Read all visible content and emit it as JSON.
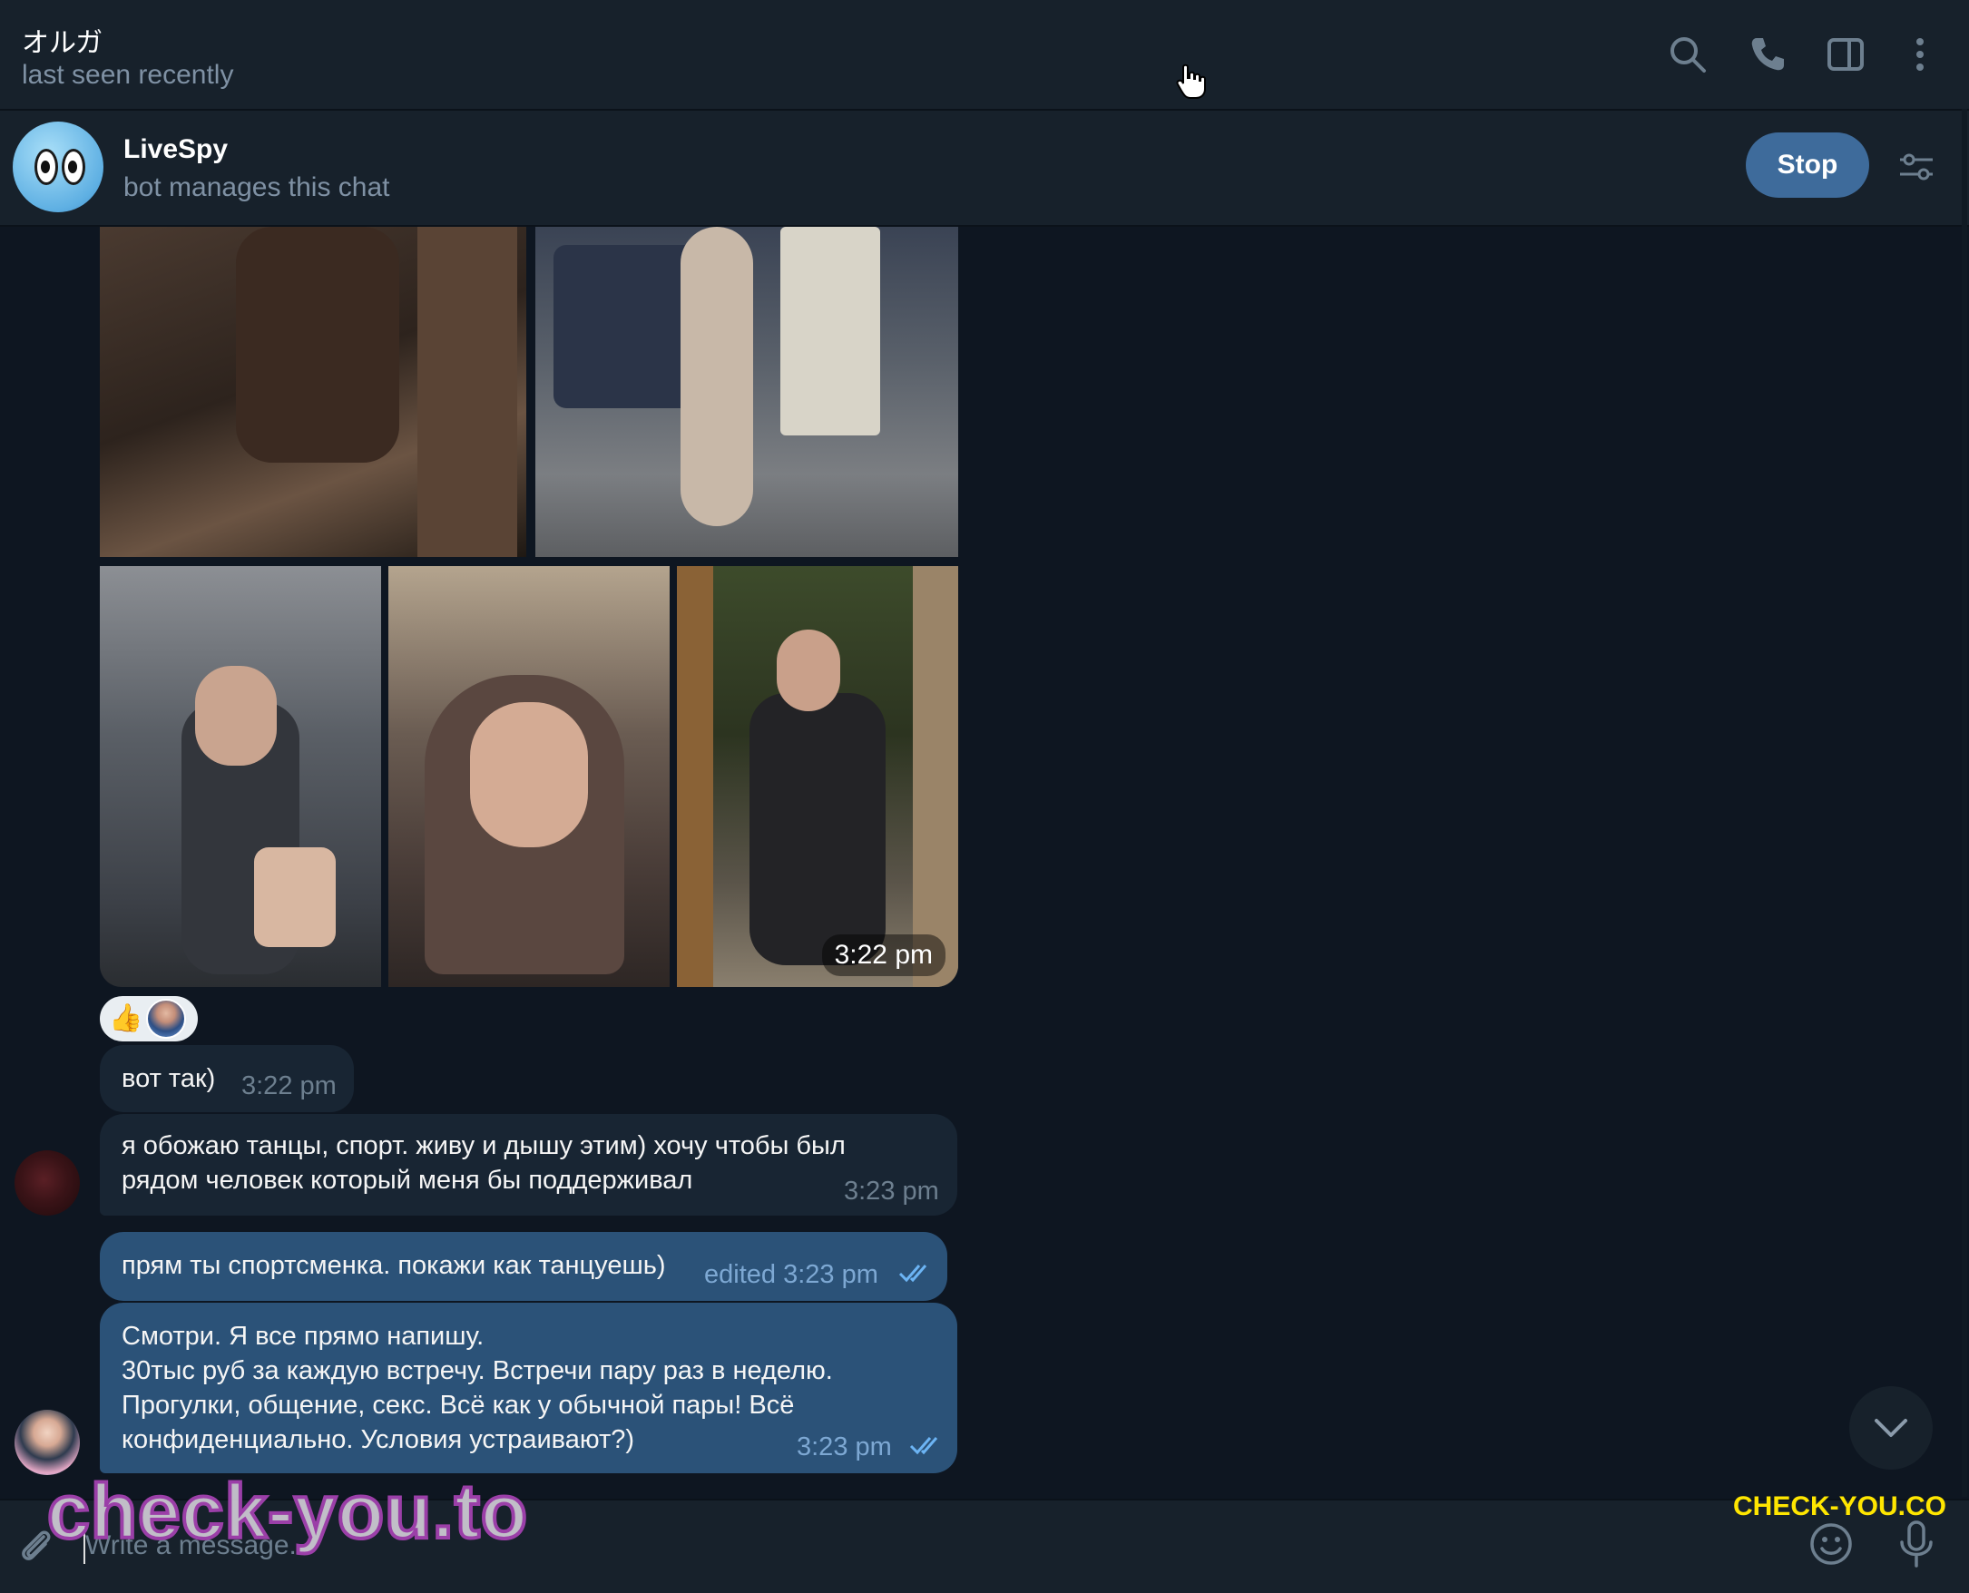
{
  "header": {
    "title": "オルガ",
    "status": "last seen recently",
    "icons": [
      "search-icon",
      "phone-icon",
      "sidebar-toggle-icon",
      "more-vertical-icon"
    ]
  },
  "bot_bar": {
    "name": "LiveSpy",
    "subtitle": "bot manages this chat",
    "stop_label": "Stop",
    "icons": [
      "bot-avatar",
      "bot-settings-icon"
    ]
  },
  "album": {
    "time": "3:22 pm",
    "photo_count": 5
  },
  "reactions": {
    "emoji": "👍"
  },
  "messages": [
    {
      "direction": "incoming",
      "text": "вот так)",
      "time": "3:22 pm"
    },
    {
      "direction": "incoming",
      "lines": [
        "я обожаю танцы, спорт. живу и дышу этим) хочу чтобы был",
        "рядом человек который меня бы поддерживал"
      ],
      "time": "3:23 pm"
    },
    {
      "direction": "outgoing",
      "text": "прям ты спортсменка. покажи как танцуешь)",
      "time": "edited 3:23 pm",
      "status": "read"
    },
    {
      "direction": "outgoing",
      "lines": [
        "Смотри. Я все прямо напишу.",
        "30тыс руб за каждую встречу. Встречи пару раз в неделю.",
        "Прогулки, общение, секс. Всё как у обычной пары! Всё",
        "конфиденциально. Условия устраивают?)"
      ],
      "time": "3:23 pm",
      "status": "read"
    }
  ],
  "composer": {
    "placeholder": "Write a message..."
  },
  "watermarks": {
    "left": "check-you.to",
    "right": "CHECK-YOU.CO"
  },
  "colors": {
    "background": "#0e1621",
    "panel": "#17212b",
    "incoming_bubble": "#182533",
    "outgoing_bubble": "#2b5278",
    "accent": "#3e6b9b",
    "read_ticks": "#6cb4f4"
  }
}
